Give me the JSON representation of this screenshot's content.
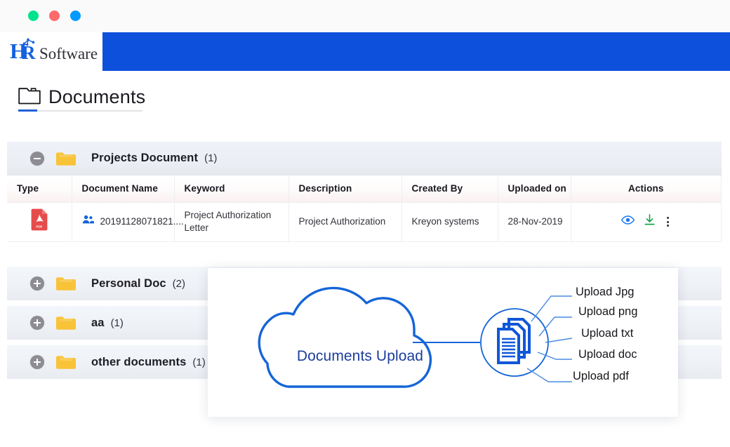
{
  "window": {
    "dots": [
      {
        "name": "window-dot-green",
        "color": "#00e38d"
      },
      {
        "name": "window-dot-red",
        "color": "#fd6a6a"
      },
      {
        "name": "window-dot-blue",
        "color": "#009bff"
      }
    ]
  },
  "brand": {
    "mark": "HR",
    "word": "Software",
    "bar_color": "#0d50dc"
  },
  "page": {
    "title": "Documents",
    "title_icon": "folder-outline-icon",
    "accent_color": "#2360d8"
  },
  "folders": [
    {
      "name": "Projects Document",
      "count": "(1)",
      "expanded": true,
      "toggle_icon": "minus-circle-icon"
    },
    {
      "name": "Personal Doc",
      "count": "(2)",
      "expanded": false,
      "toggle_icon": "plus-circle-icon"
    },
    {
      "name": "aa",
      "count": "(1)",
      "expanded": false,
      "toggle_icon": "plus-circle-icon"
    },
    {
      "name": "other documents",
      "count": "(1)",
      "expanded": false,
      "toggle_icon": "plus-circle-icon"
    }
  ],
  "table": {
    "columns": [
      "Type",
      "Document Name",
      "Keyword",
      "Description",
      "Created By",
      "Uploaded on",
      "Actions"
    ],
    "rows": [
      {
        "type_icon": "pdf-file-icon",
        "type_label": "PDF",
        "document_name": "20191128071821....",
        "document_name_icon": "people-icon",
        "keyword": "Project Authorization Letter",
        "description": "Project Authorization",
        "created_by": "Kreyon systems",
        "uploaded_on": "28-Nov-2019",
        "actions": [
          "view-icon",
          "download-icon",
          "more-options-icon"
        ]
      }
    ]
  },
  "diagram": {
    "cloud_label": "Documents Upload",
    "node_icon": "documents-stack-icon",
    "upload_labels": [
      "Upload Jpg",
      "Upload png",
      "Upload txt",
      "Upload doc",
      "Upload pdf"
    ],
    "line_color": "#1565d8",
    "text_color": "#1d3e9b"
  }
}
